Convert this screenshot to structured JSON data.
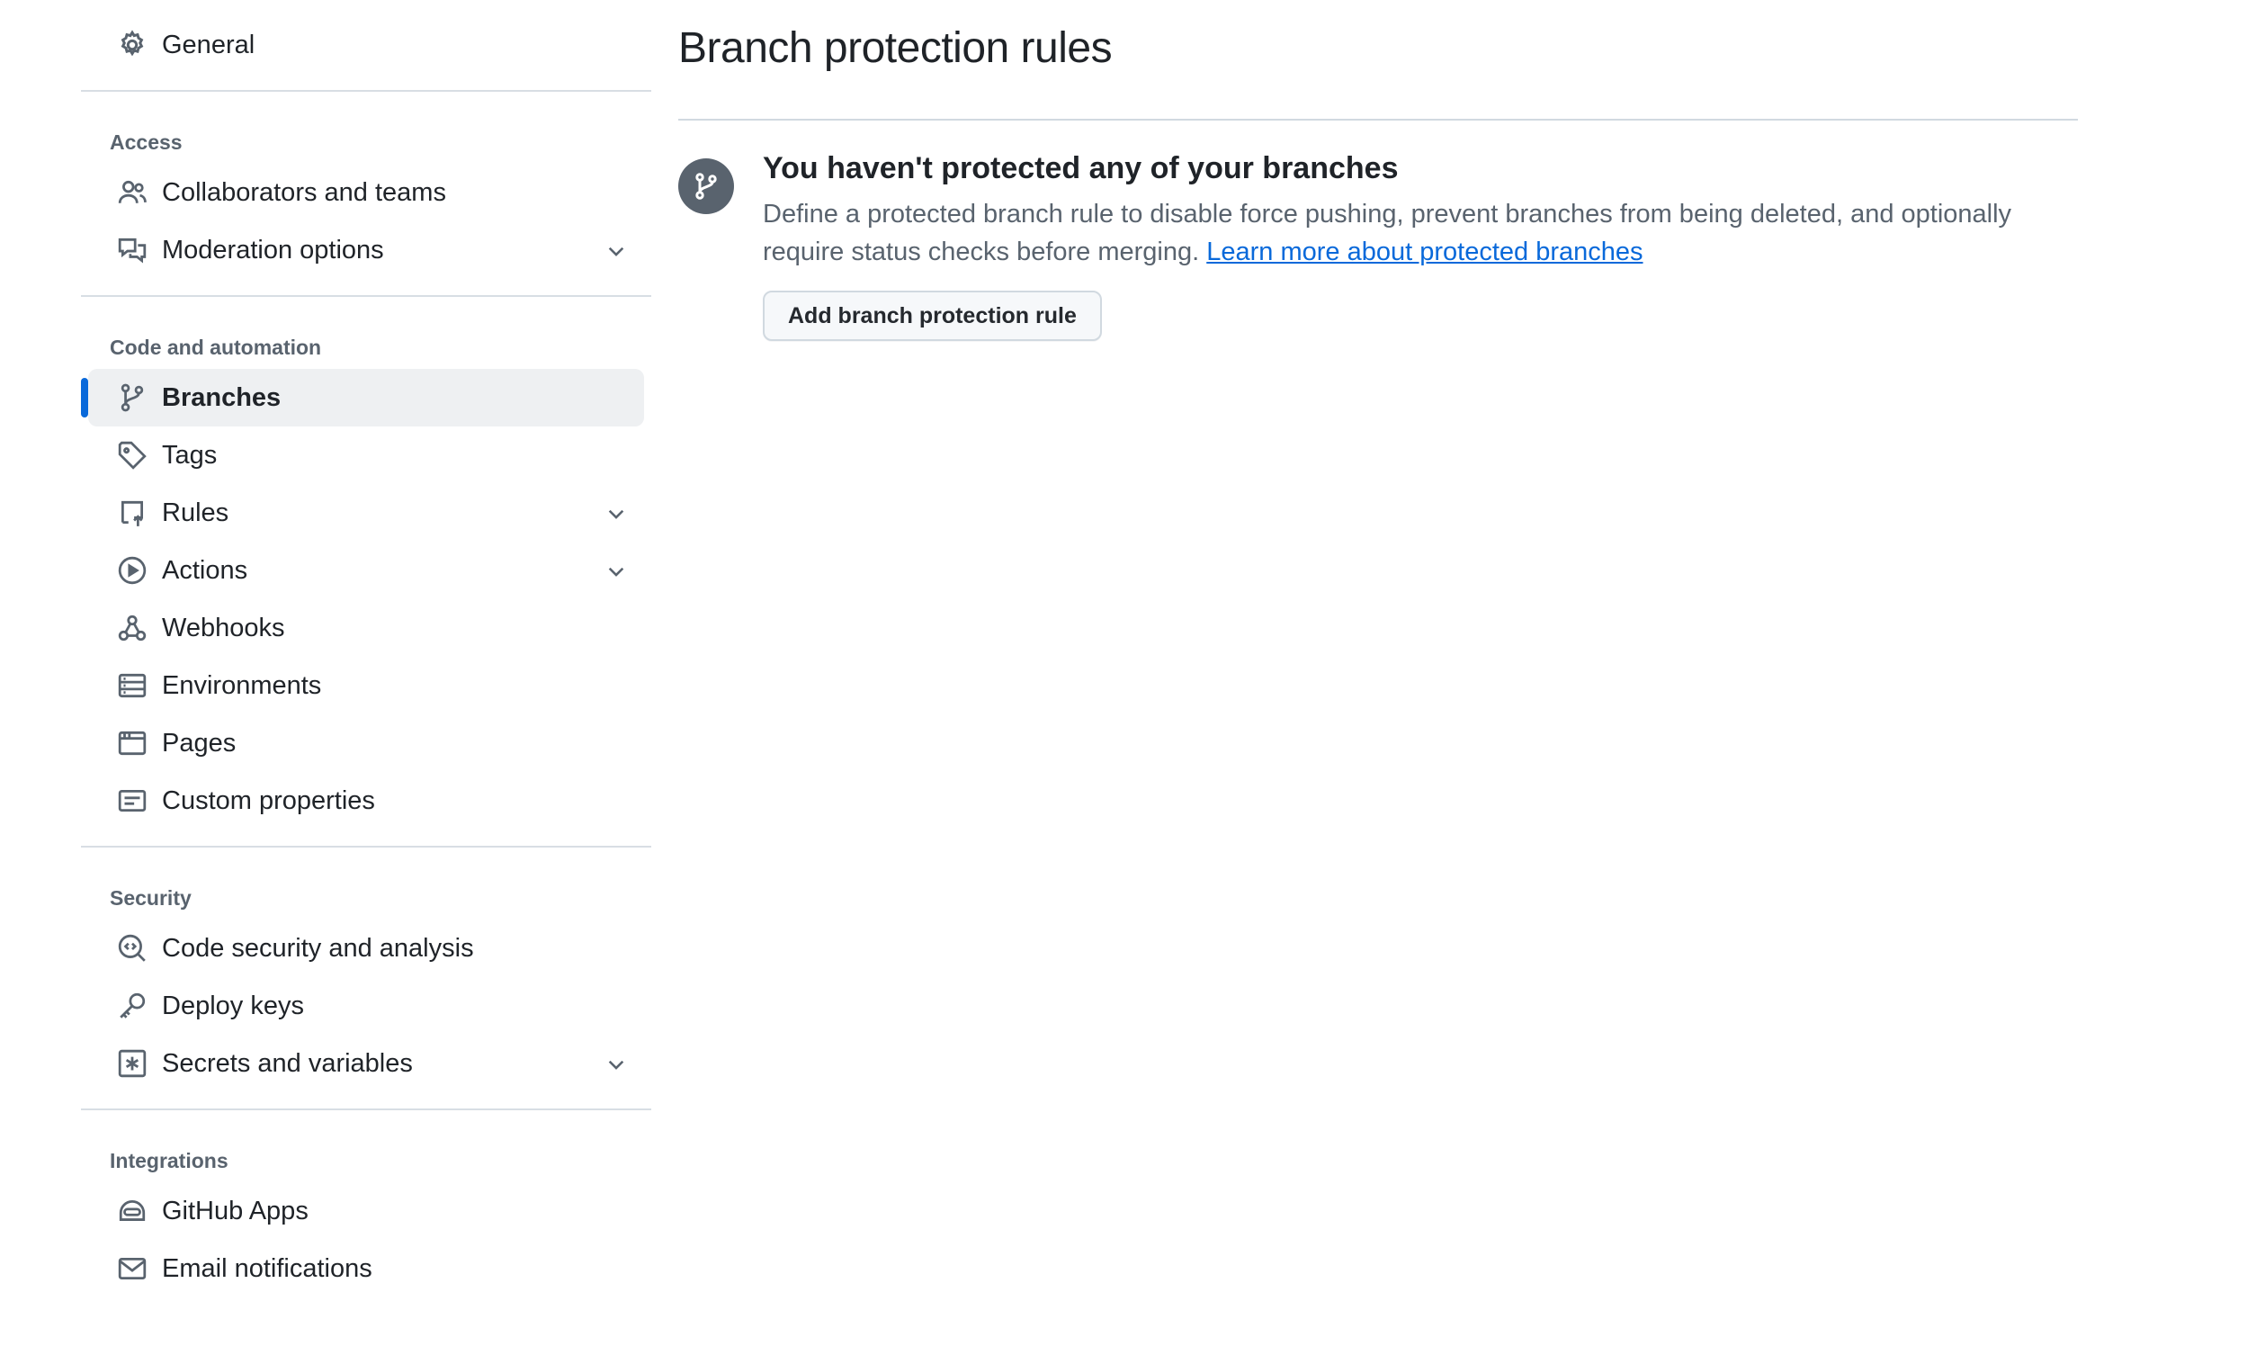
{
  "sidebar": {
    "general": {
      "label": "General",
      "icon": "gear-icon"
    },
    "groups": [
      {
        "title": "Access",
        "items": [
          {
            "label": "Collaborators and teams",
            "icon": "people-icon"
          },
          {
            "label": "Moderation options",
            "icon": "comment-discussion-icon",
            "expandable": true
          }
        ]
      },
      {
        "title": "Code and automation",
        "items": [
          {
            "label": "Branches",
            "icon": "git-branch-icon",
            "selected": true
          },
          {
            "label": "Tags",
            "icon": "tag-icon"
          },
          {
            "label": "Rules",
            "icon": "repo-push-icon",
            "expandable": true
          },
          {
            "label": "Actions",
            "icon": "play-icon",
            "expandable": true
          },
          {
            "label": "Webhooks",
            "icon": "webhook-icon"
          },
          {
            "label": "Environments",
            "icon": "server-icon"
          },
          {
            "label": "Pages",
            "icon": "browser-icon"
          },
          {
            "label": "Custom properties",
            "icon": "note-icon"
          }
        ]
      },
      {
        "title": "Security",
        "items": [
          {
            "label": "Code security and analysis",
            "icon": "codescan-icon"
          },
          {
            "label": "Deploy keys",
            "icon": "key-icon"
          },
          {
            "label": "Secrets and variables",
            "icon": "key-asterisk-icon",
            "expandable": true
          }
        ]
      },
      {
        "title": "Integrations",
        "items": [
          {
            "label": "GitHub Apps",
            "icon": "hubot-icon"
          },
          {
            "label": "Email notifications",
            "icon": "mail-icon"
          }
        ]
      }
    ]
  },
  "main": {
    "title": "Branch protection rules",
    "blankslate": {
      "icon": "git-branch-icon",
      "heading": "You haven't protected any of your branches",
      "description": "Define a protected branch rule to disable force pushing, prevent branches from being deleted, and optionally require status checks before merging.",
      "link_text": "Learn more about protected branches",
      "button_label": "Add branch protection rule"
    }
  },
  "colors": {
    "accent": "#0969da",
    "selected_bg": "#eef0f2",
    "muted_text": "#59636e",
    "border": "#d1d9e0"
  }
}
